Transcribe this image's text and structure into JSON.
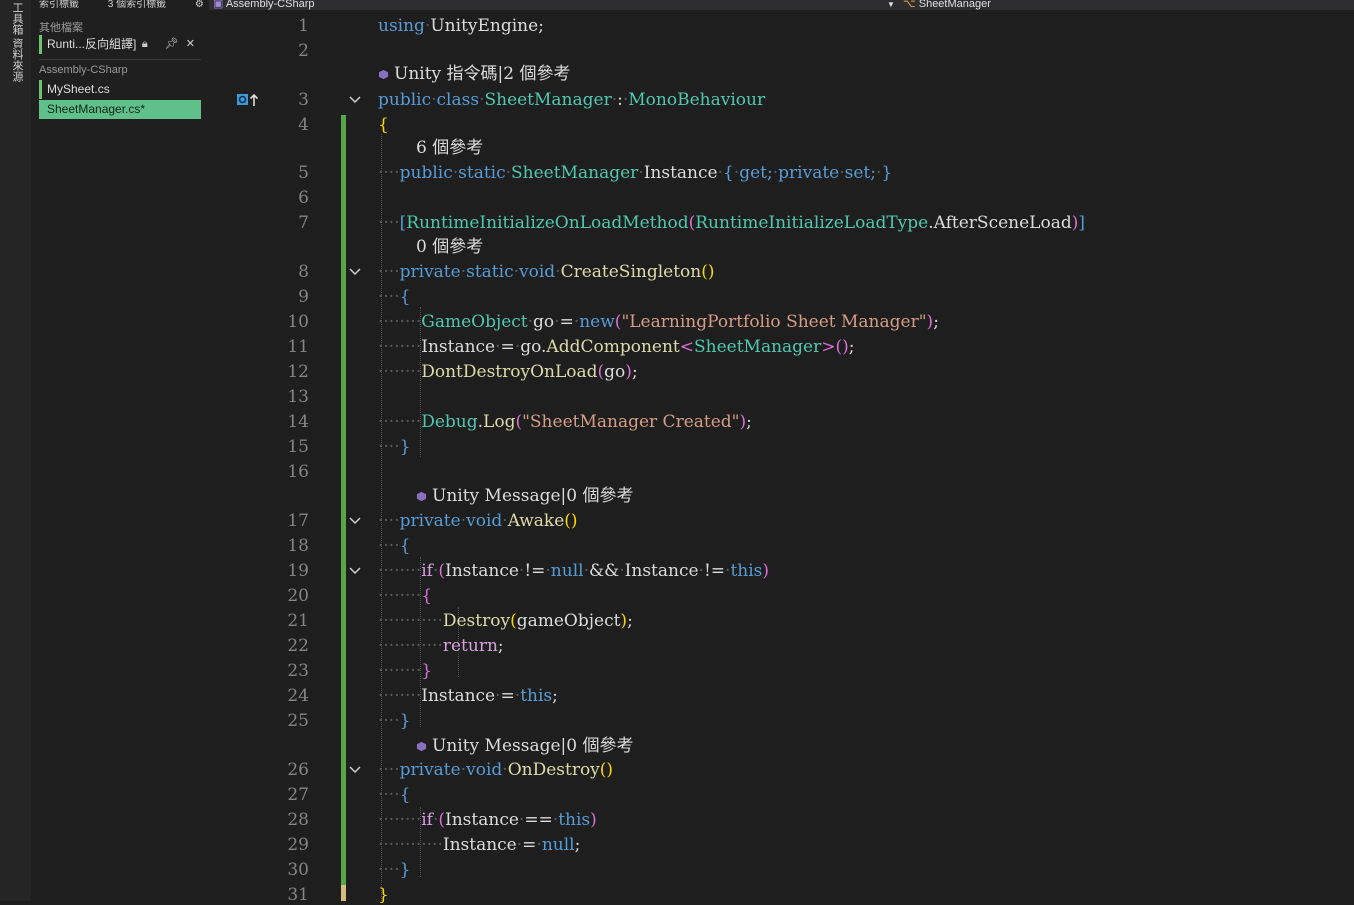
{
  "left_tabs": [
    "工具箱",
    "資料來源"
  ],
  "panel": {
    "top_items": [
      "索引標籤",
      "3 個索引標籤"
    ],
    "groups": [
      "其他檔案",
      "Assembly-CSharp"
    ],
    "pinned_file": "Runti...反向組譯]",
    "files": [
      "MySheet.cs",
      "SheetManager.cs*"
    ]
  },
  "nav": {
    "project": "Assembly-CSharp",
    "type": "SheetManager"
  },
  "codelens": {
    "unity_script": "Unity 指令碼|2 個參考",
    "refs_6": "6 個參考",
    "refs_0": "0 個參考",
    "unity_msg": "Unity Message|0 個參考"
  },
  "line_numbers": [
    "1",
    "2",
    "3",
    "4",
    "5",
    "6",
    "7",
    "8",
    "9",
    "10",
    "11",
    "12",
    "13",
    "14",
    "15",
    "16",
    "17",
    "18",
    "19",
    "20",
    "21",
    "22",
    "23",
    "24",
    "25",
    "26",
    "27",
    "28",
    "29",
    "30",
    "31"
  ],
  "code": {
    "l1": [
      "using",
      "UnityEngine",
      ";"
    ],
    "l3": [
      "public",
      "class",
      "SheetManager",
      ":",
      "MonoBehaviour"
    ],
    "l4": "{",
    "l5": [
      "public",
      "static",
      "SheetManager",
      "Instance",
      "{",
      "get;",
      "private",
      "set;",
      "}"
    ],
    "l7": [
      "[",
      "RuntimeInitializeOnLoadMethod",
      "(",
      "RuntimeInitializeLoadType",
      ".AfterSceneLoad",
      ")",
      "]"
    ],
    "l8": [
      "private",
      "static",
      "void",
      "CreateSingleton",
      "()"
    ],
    "l9": "{",
    "l10": [
      "GameObject",
      "go",
      "=",
      "new",
      "(",
      "\"LearningPortfolio Sheet Manager\"",
      ")",
      ";"
    ],
    "l11": [
      "Instance",
      "=",
      "go.",
      "AddComponent",
      "<",
      "SheetManager",
      ">",
      "()",
      ";"
    ],
    "l12": [
      "DontDestroyOnLoad",
      "(",
      "go",
      ")",
      ";"
    ],
    "l14": [
      "Debug",
      ".",
      "Log",
      "(",
      "\"SheetManager Created\"",
      ")",
      ";"
    ],
    "l15": "}",
    "l17": [
      "private",
      "void",
      "Awake",
      "()"
    ],
    "l18": "{",
    "l19": [
      "if",
      "(",
      "Instance",
      "!=",
      "null",
      "&&",
      "Instance",
      "!=",
      "this",
      ")"
    ],
    "l20": "{",
    "l21": [
      "Destroy",
      "(",
      "gameObject",
      ")",
      ";"
    ],
    "l22": [
      "return",
      ";"
    ],
    "l23": "}",
    "l24": [
      "Instance",
      "=",
      "this",
      ";"
    ],
    "l25": "}",
    "l26": [
      "private",
      "void",
      "OnDestroy",
      "()"
    ],
    "l27": "{",
    "l28": [
      "if",
      "(",
      "Instance",
      "==",
      "this",
      ")"
    ],
    "l29": [
      "Instance",
      "=",
      "null",
      ";"
    ],
    "l30": "}",
    "l31": "}"
  },
  "colors": {
    "keyword": "#569cd6",
    "type": "#4ec9b0",
    "method": "#dcdcaa",
    "string": "#d69d85",
    "control": "#d8a0df",
    "change_bar": "#57a64a",
    "active_tab": "#5fc08a"
  }
}
